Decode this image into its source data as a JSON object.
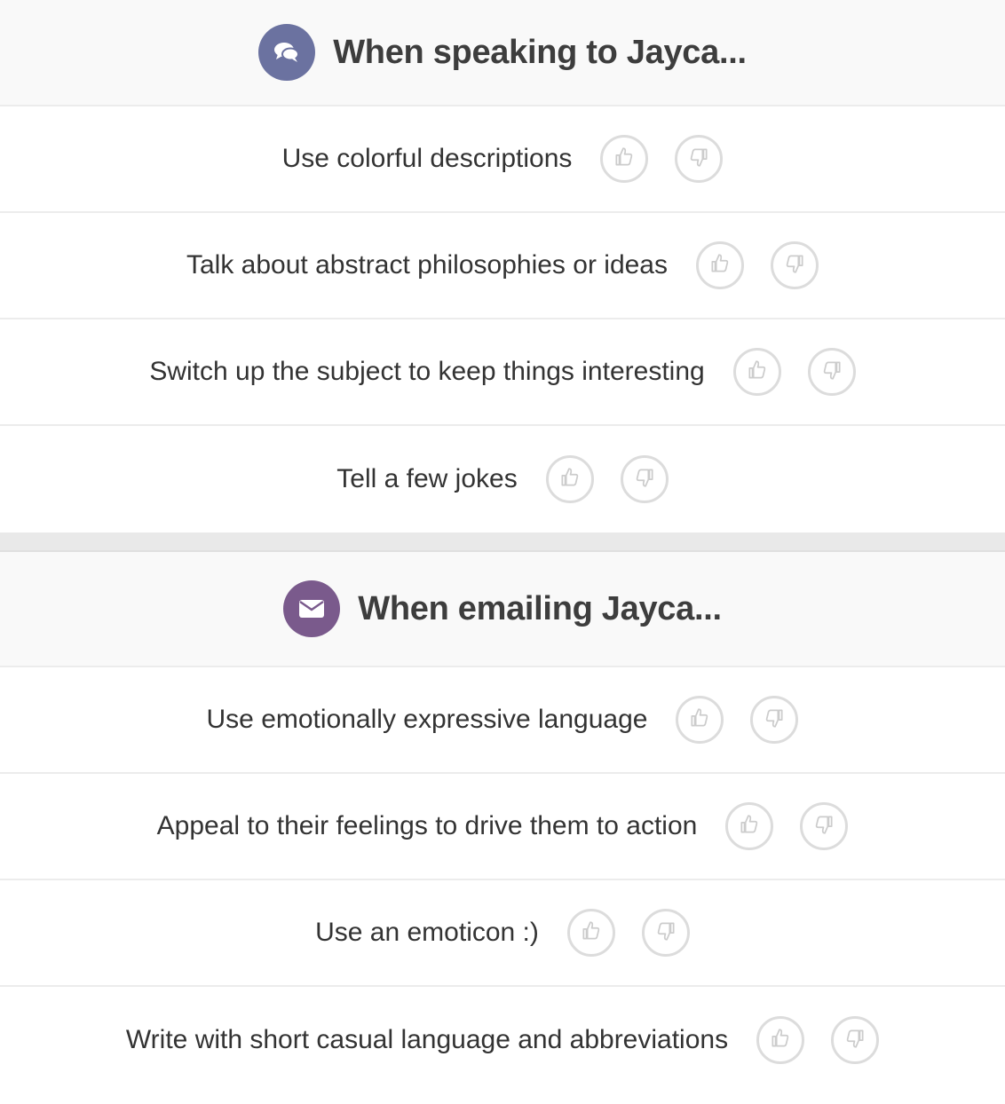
{
  "sections": [
    {
      "title": "When speaking to Jayca...",
      "icon": "chat-bubbles-icon",
      "accent": "#6b72a0",
      "items": [
        "Use colorful descriptions",
        "Talk about abstract philosophies or ideas",
        "Switch up the subject to keep things interesting",
        "Tell a few jokes"
      ]
    },
    {
      "title": "When emailing Jayca...",
      "icon": "envelope-icon",
      "accent": "#7a5a8c",
      "items": [
        "Use emotionally expressive language",
        "Appeal to their feelings to drive them to action",
        "Use an emoticon :)",
        "Write with short casual language and abbreviations"
      ]
    }
  ],
  "vote_icons": {
    "up": "thumbs-up-icon",
    "down": "thumbs-down-icon"
  }
}
